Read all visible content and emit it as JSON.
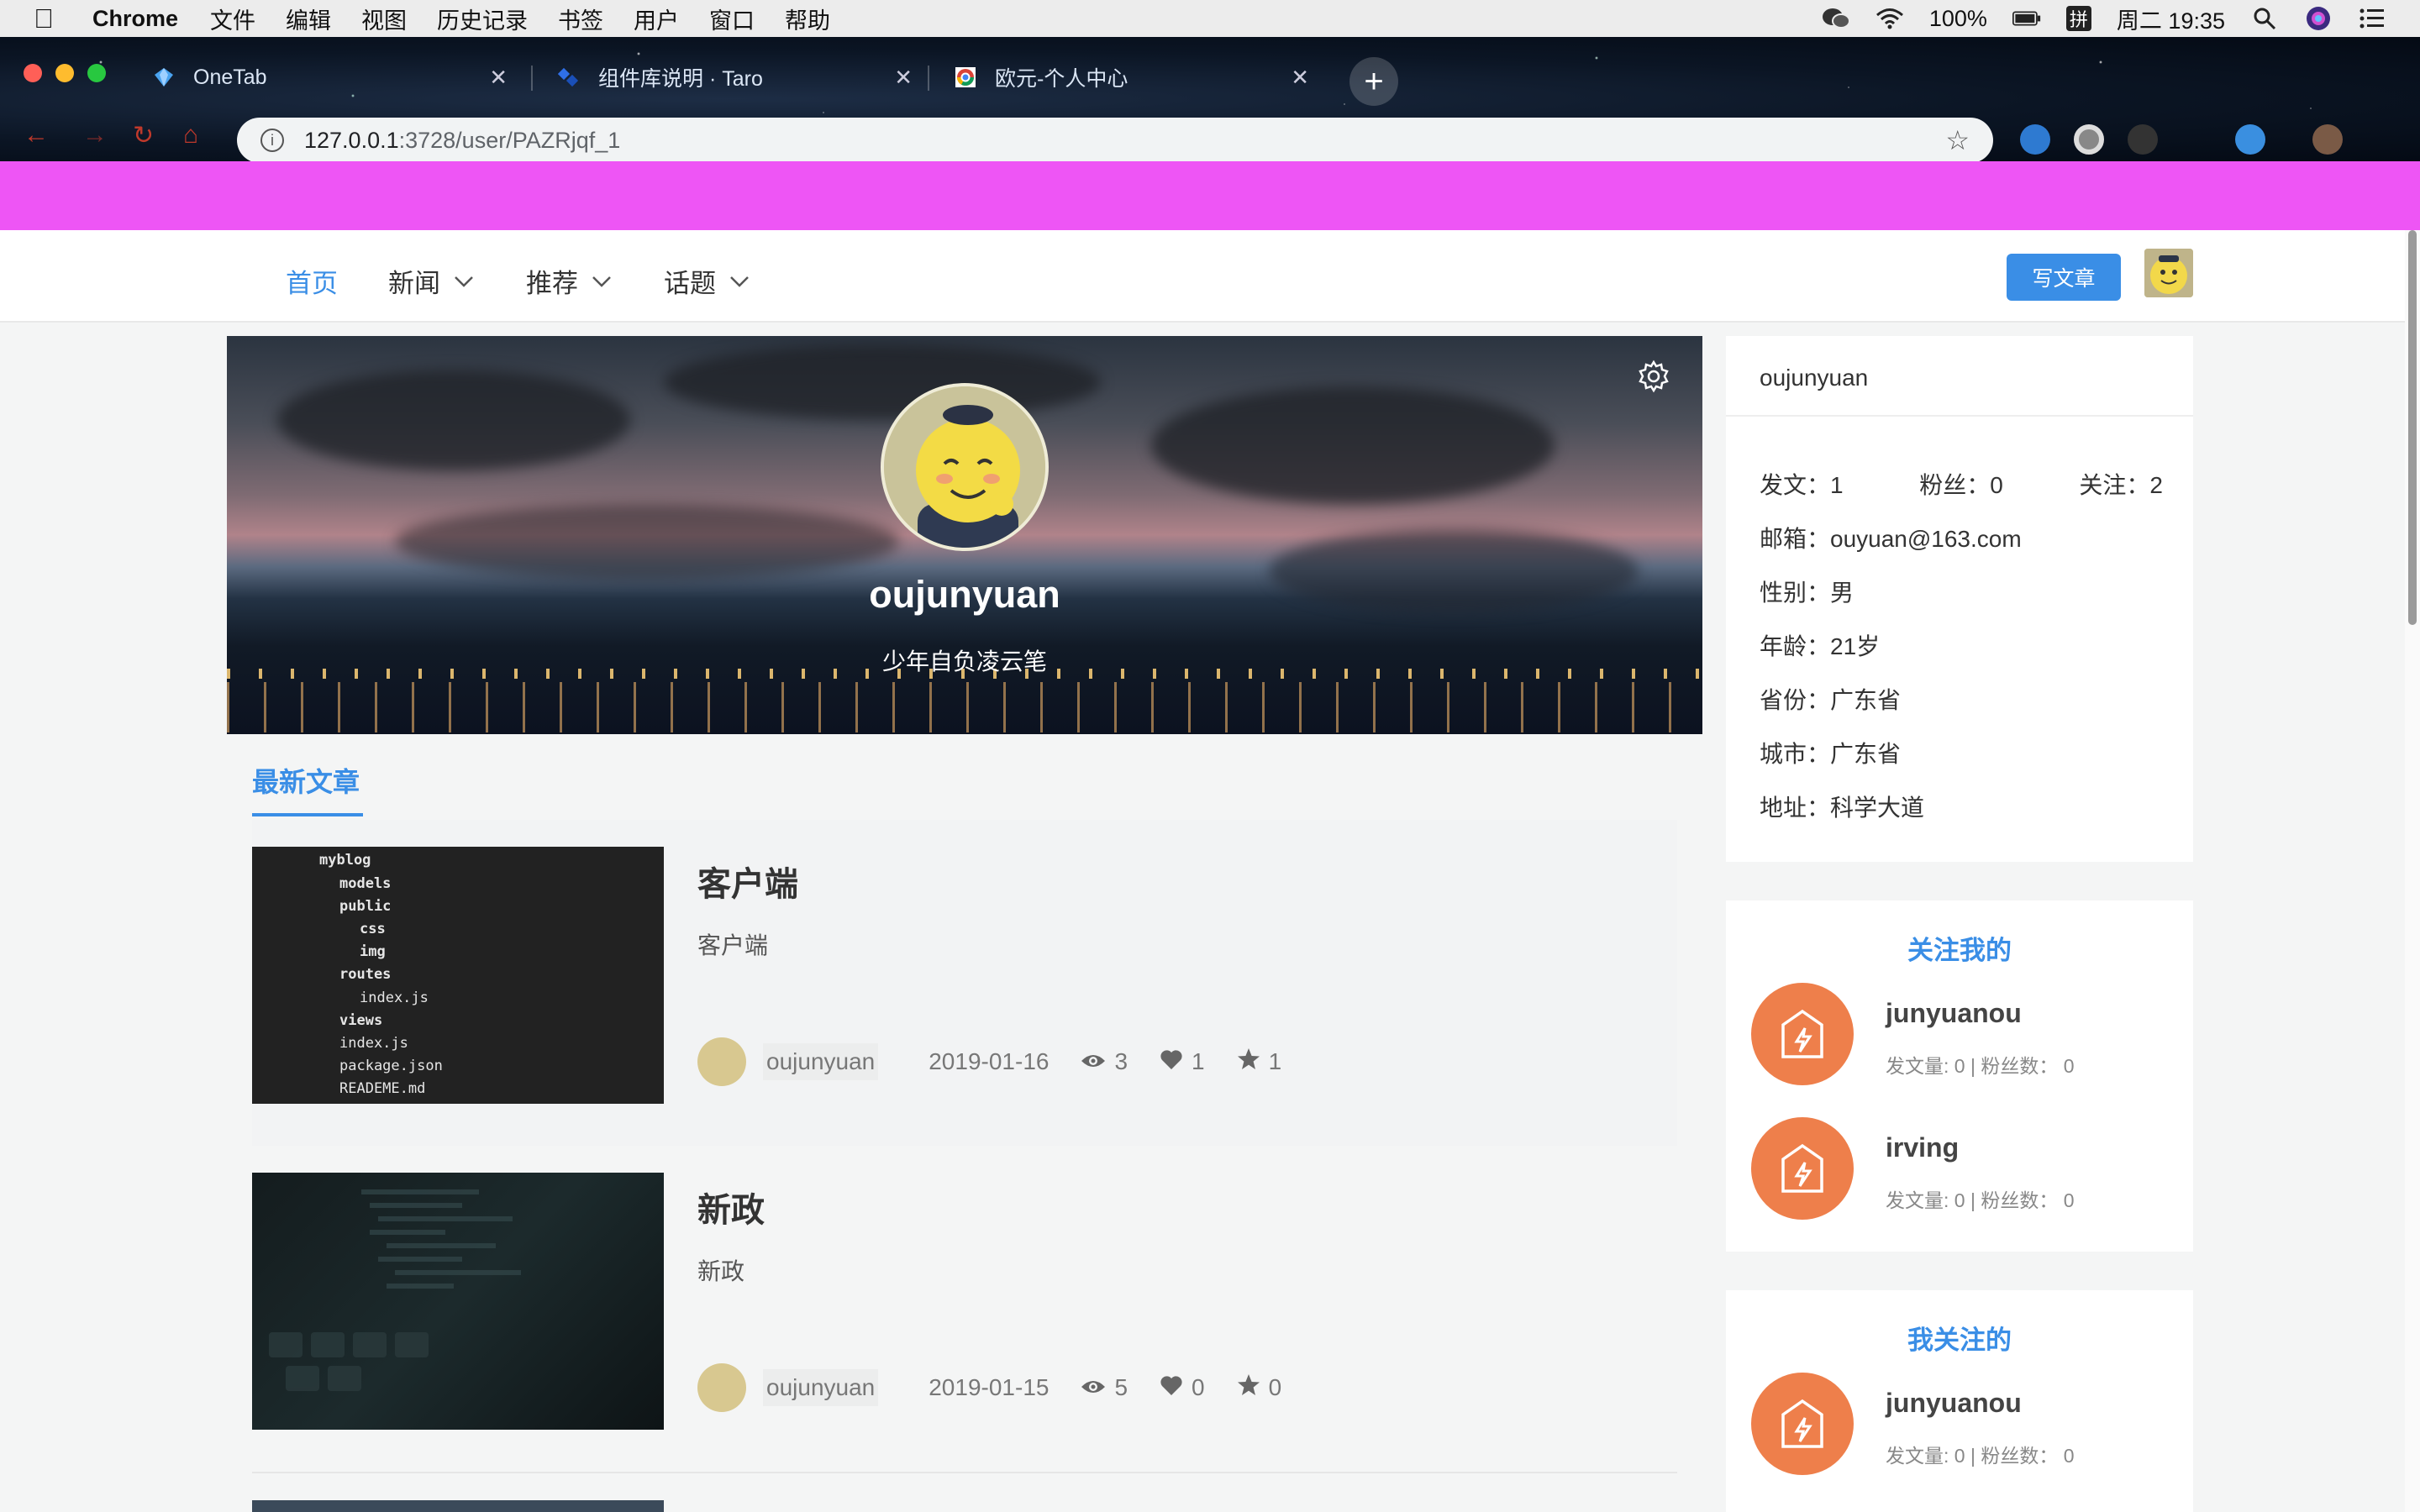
{
  "menubar": {
    "app_name": "Chrome",
    "items": [
      "文件",
      "编辑",
      "视图",
      "历史记录",
      "书签",
      "用户",
      "窗口",
      "帮助"
    ],
    "battery": "100%",
    "input_method": "拼",
    "clock": "周二 19:35"
  },
  "browser": {
    "tabs": [
      {
        "title": "OneTab",
        "icon": "onetab-icon"
      },
      {
        "title": "组件库说明 · Taro",
        "icon": "taro-icon"
      },
      {
        "title": "欧元-个人中心",
        "icon": "chrome-icon"
      }
    ],
    "url_host": "127.0.0.1",
    "url_path": ":3728/user/PAZRjqf_1"
  },
  "site_nav": {
    "home": "首页",
    "news": "新闻",
    "recommend": "推荐",
    "topics": "话题",
    "write_button": "写文章"
  },
  "hero": {
    "username": "oujunyuan",
    "motto": "少年自负凌云笔"
  },
  "latest": {
    "tab_label": "最新文章",
    "articles": [
      {
        "title": "客户端",
        "summary": "客户端",
        "author": "oujunyuan",
        "date": "2019-01-16",
        "views": "3",
        "likes": "1",
        "stars": "1",
        "thumb_tree": [
          "myblog",
          "models",
          "public",
          "css",
          "img",
          "routes",
          "index.js",
          "views",
          "index.js",
          "package.json",
          "READEME.md"
        ]
      },
      {
        "title": "新政",
        "summary": "新政",
        "author": "oujunyuan",
        "date": "2019-01-15",
        "views": "5",
        "likes": "0",
        "stars": "0"
      }
    ]
  },
  "profile": {
    "name": "oujunyuan",
    "posts": "发文：1",
    "fans": "粉丝：0",
    "follows": "关注：2",
    "email": "邮箱：ouyuan@163.com",
    "gender": "性别：男",
    "age": "年龄：21岁",
    "province": "省份：广东省",
    "city": "城市：广东省",
    "address": "地址：科学大道"
  },
  "followers": {
    "heading": "关注我的",
    "items": [
      {
        "name": "junyuanou",
        "stats": "发文量: 0 | 粉丝数： 0"
      },
      {
        "name": "irving",
        "stats": "发文量: 0 | 粉丝数： 0"
      }
    ]
  },
  "following": {
    "heading": "我关注的",
    "items": [
      {
        "name": "junyuanou",
        "stats": "发文量: 0 | 粉丝数： 0"
      }
    ]
  },
  "colors": {
    "accent": "#3a8ee6",
    "banner": "#ee55f5",
    "follow_avatar": "#ee7f4b"
  }
}
